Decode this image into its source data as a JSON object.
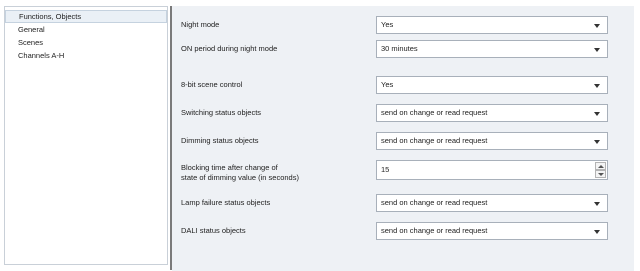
{
  "sidebar": {
    "items": [
      {
        "label": "Functions, Objects"
      },
      {
        "label": "General"
      },
      {
        "label": "Scenes"
      },
      {
        "label": "Channels A-H"
      }
    ]
  },
  "params": {
    "night_mode": {
      "label": "Night mode",
      "value": "Yes"
    },
    "on_period": {
      "label": "ON period during night mode",
      "value": "30 minutes"
    },
    "scene_control": {
      "label": "8-bit scene control",
      "value": "Yes"
    },
    "switching_status": {
      "label": "Switching status objects",
      "value": "send on change or read request"
    },
    "dimming_status": {
      "label": "Dimming status objects",
      "value": "send on change or read request"
    },
    "blocking_time": {
      "label_line1": "Blocking time after change of",
      "label_line2": "state of dimming value (in seconds)",
      "value": "15"
    },
    "lamp_failure": {
      "label": "Lamp failure status objects",
      "value": "send on change or read request"
    },
    "dali_status": {
      "label": "DALI status objects",
      "value": "send on change or read request"
    }
  }
}
